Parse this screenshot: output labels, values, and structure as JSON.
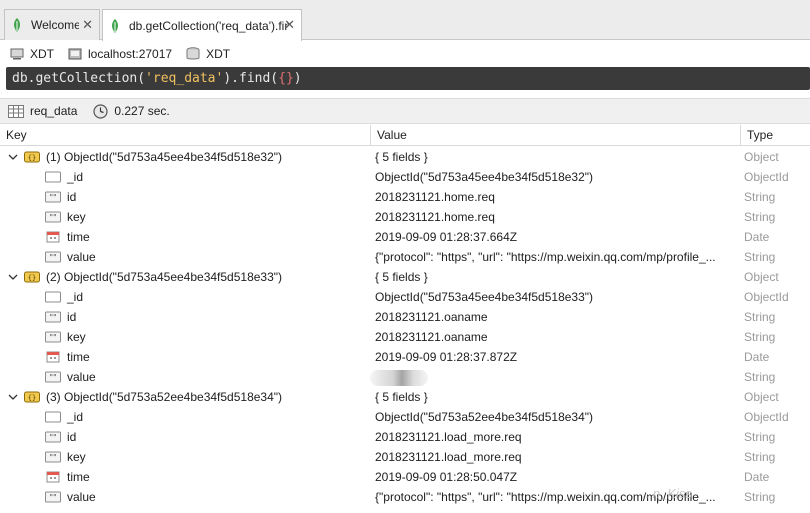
{
  "tabs": [
    {
      "label": "Welcome",
      "close": "✕"
    },
    {
      "label": "db.getCollection('req_data').fin...",
      "close": "✕"
    }
  ],
  "connection": {
    "database_user": "XDT",
    "server": "localhost:27017",
    "database": "XDT"
  },
  "query": {
    "prefix": "db.getCollection(",
    "collection": "'req_data'",
    "middle": ").find(",
    "braces": "{}",
    "suffix": ")"
  },
  "status": {
    "collection": "req_data",
    "time": "0.227 sec."
  },
  "columns": {
    "key": "Key",
    "value": "Value",
    "type": "Type"
  },
  "documents": [
    {
      "key": "(1) ObjectId(\"5d753a45ee4be34f5d518e32\")",
      "value": "{ 5 fields }",
      "type": "Object",
      "fields": [
        {
          "key": "_id",
          "value": "ObjectId(\"5d753a45ee4be34f5d518e32\")",
          "type": "ObjectId",
          "icon": "objectid-icon"
        },
        {
          "key": "id",
          "value": "2018231121.home.req",
          "type": "String",
          "icon": "string-icon"
        },
        {
          "key": "key",
          "value": "2018231121.home.req",
          "type": "String",
          "icon": "string-icon"
        },
        {
          "key": "time",
          "value": "2019-09-09 01:28:37.664Z",
          "type": "Date",
          "icon": "date-icon"
        },
        {
          "key": "value",
          "value": "{\"protocol\": \"https\", \"url\": \"https://mp.weixin.qq.com/mp/profile_...",
          "type": "String",
          "icon": "string-icon"
        }
      ]
    },
    {
      "key": "(2) ObjectId(\"5d753a45ee4be34f5d518e33\")",
      "value": "{ 5 fields }",
      "type": "Object",
      "fields": [
        {
          "key": "_id",
          "value": "ObjectId(\"5d753a45ee4be34f5d518e33\")",
          "type": "ObjectId",
          "icon": "objectid-icon"
        },
        {
          "key": "id",
          "value": "2018231121.oaname",
          "type": "String",
          "icon": "string-icon"
        },
        {
          "key": "key",
          "value": "2018231121.oaname",
          "type": "String",
          "icon": "string-icon"
        },
        {
          "key": "time",
          "value": "2019-09-09 01:28:37.872Z",
          "type": "Date",
          "icon": "date-icon"
        },
        {
          "key": "value",
          "value": "",
          "type": "String",
          "icon": "string-icon"
        }
      ]
    },
    {
      "key": "(3) ObjectId(\"5d753a52ee4be34f5d518e34\")",
      "value": "{ 5 fields }",
      "type": "Object",
      "fields": [
        {
          "key": "_id",
          "value": "ObjectId(\"5d753a52ee4be34f5d518e34\")",
          "type": "ObjectId",
          "icon": "objectid-icon"
        },
        {
          "key": "id",
          "value": "2018231121.load_more.req",
          "type": "String",
          "icon": "string-icon"
        },
        {
          "key": "key",
          "value": "2018231121.load_more.req",
          "type": "String",
          "icon": "string-icon"
        },
        {
          "key": "time",
          "value": "2019-09-09 01:28:50.047Z",
          "type": "Date",
          "icon": "date-icon"
        },
        {
          "key": "value",
          "value": "{\"protocol\": \"https\", \"url\": \"https://mp.weixin.qq.com/mp/profile_...",
          "type": "String",
          "icon": "string-icon"
        }
      ]
    }
  ],
  "watermark": "...n_Kiss",
  "colors": {
    "leaf": "#3fa34d",
    "query_bg": "#3a3a3a",
    "type_text": "#9a9a9a"
  }
}
